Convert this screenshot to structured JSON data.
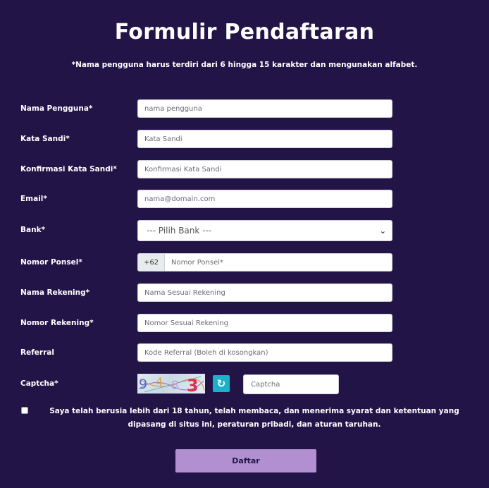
{
  "page": {
    "title": "Formulir Pendaftaran",
    "subtitle": "*Nama pengguna harus terdiri dari 6 hingga 15 karakter dan mengunakan alfabet."
  },
  "form": {
    "username": {
      "label": "Nama Pengguna*",
      "placeholder": "nama pengguna"
    },
    "password": {
      "label": "Kata Sandi*",
      "placeholder": "Kata Sandi"
    },
    "password_confirm": {
      "label": "Konfirmasi Kata Sandi*",
      "placeholder": "Konfirmasi Kata Sandi"
    },
    "email": {
      "label": "Email*",
      "placeholder": "nama@domain.com"
    },
    "bank": {
      "label": "Bank*",
      "selected": "--- Pilih Bank ---"
    },
    "phone": {
      "label": "Nomor Ponsel*",
      "prefix": "+62",
      "placeholder": "Nomor Ponsel*"
    },
    "account_name": {
      "label": "Nama Rekening*",
      "placeholder": "Nama Sesuai Rekening"
    },
    "account_number": {
      "label": "Nomor Rekening*",
      "placeholder": "Nomor Sesuai Rekening"
    },
    "referral": {
      "label": "Referral",
      "placeholder": "Kode Referral (Boleh di kosongkan)"
    },
    "captcha": {
      "label": "Captcha*",
      "image_text": "9483",
      "placeholder": "Captcha",
      "refresh_icon": "refresh-icon"
    },
    "terms_text": "Saya telah berusia lebih dari 18 tahun, telah membaca, dan menerima syarat dan ketentuan yang dipasang di situs ini, peraturan pribadi, dan aturan taruhan.",
    "terms_checked": false,
    "submit_label": "Daftar"
  },
  "colors": {
    "background": "#231448",
    "button": "#b28fd1",
    "refresh": "#1bb1c9"
  }
}
